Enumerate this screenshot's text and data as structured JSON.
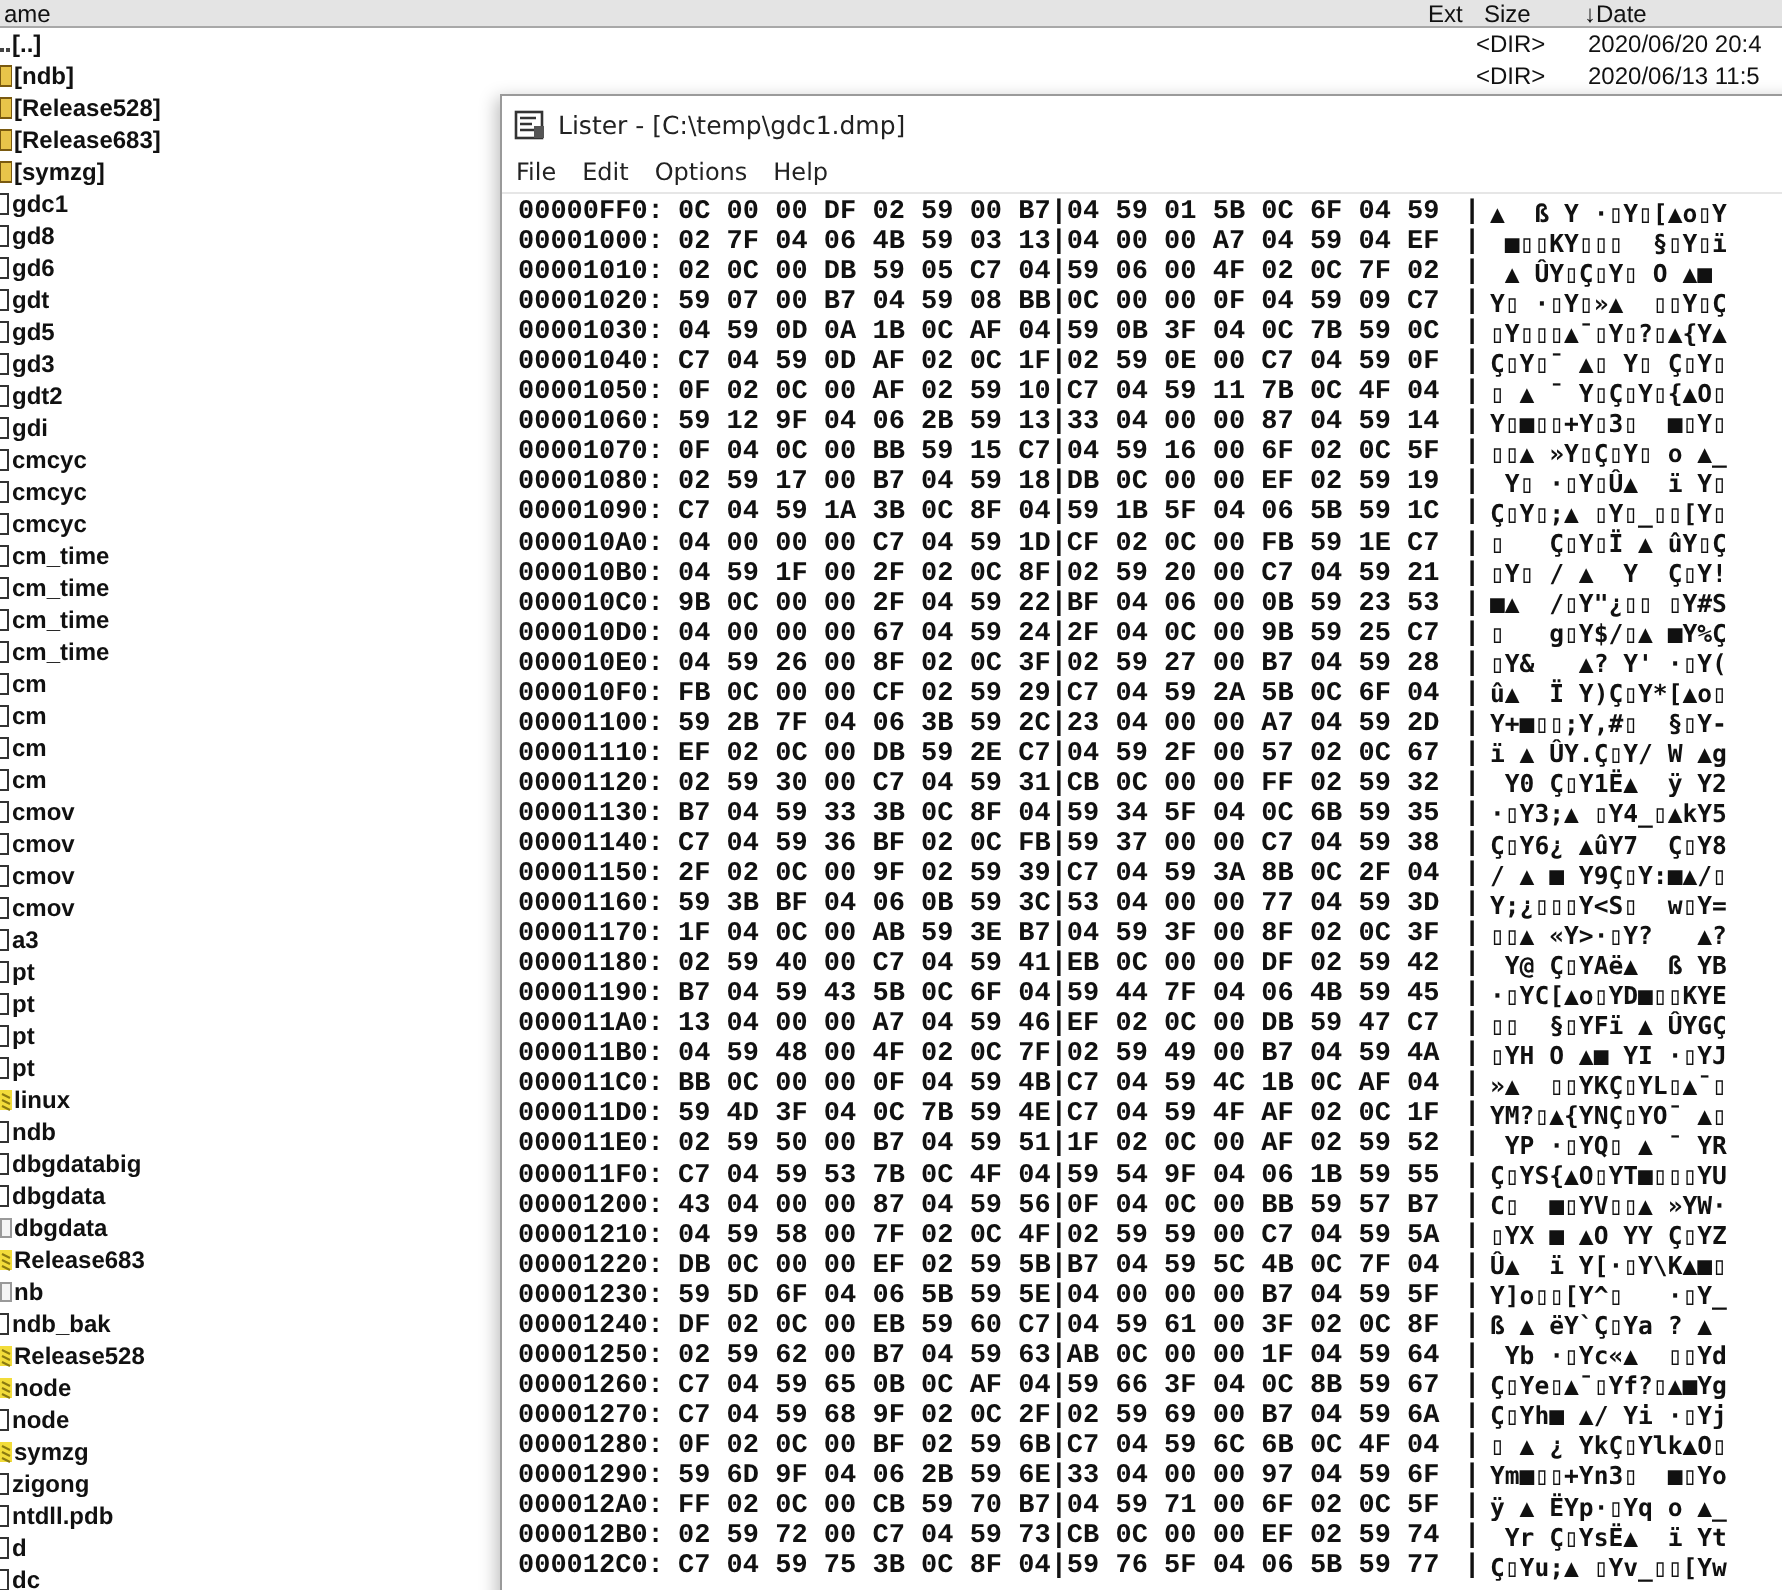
{
  "file_panel": {
    "columns": [
      "ame",
      "Ext",
      "Size",
      "↓Date"
    ],
    "items": [
      {
        "name": "[..]",
        "kind": "up",
        "size": "<DIR>",
        "date": "2020/06/20 20:4"
      },
      {
        "name": "[ndb]",
        "kind": "folder",
        "size": "<DIR>",
        "date": "2020/06/13 11:5"
      },
      {
        "name": "[Release528]",
        "kind": "folder"
      },
      {
        "name": "[Release683]",
        "kind": "folder"
      },
      {
        "name": "[symzg]",
        "kind": "folder"
      },
      {
        "name": "gdc1",
        "kind": "file"
      },
      {
        "name": "gd8",
        "kind": "file"
      },
      {
        "name": "gd6",
        "kind": "file"
      },
      {
        "name": "gdt",
        "kind": "file"
      },
      {
        "name": "gd5",
        "kind": "file"
      },
      {
        "name": "gd3",
        "kind": "file"
      },
      {
        "name": "gdt2",
        "kind": "file"
      },
      {
        "name": "gdi",
        "kind": "file"
      },
      {
        "name": "cmcyc",
        "kind": "file"
      },
      {
        "name": "cmcyc",
        "kind": "file"
      },
      {
        "name": "cmcyc",
        "kind": "file"
      },
      {
        "name": "cm_time",
        "kind": "file"
      },
      {
        "name": "cm_time",
        "kind": "file"
      },
      {
        "name": "cm_time",
        "kind": "file"
      },
      {
        "name": "cm_time",
        "kind": "file"
      },
      {
        "name": "cm",
        "kind": "file"
      },
      {
        "name": "cm",
        "kind": "file"
      },
      {
        "name": "cm",
        "kind": "file"
      },
      {
        "name": "cm",
        "kind": "file"
      },
      {
        "name": "cmov",
        "kind": "file"
      },
      {
        "name": "cmov",
        "kind": "file"
      },
      {
        "name": "cmov",
        "kind": "file"
      },
      {
        "name": "cmov",
        "kind": "file"
      },
      {
        "name": "a3",
        "kind": "file"
      },
      {
        "name": "pt",
        "kind": "file"
      },
      {
        "name": "pt",
        "kind": "file"
      },
      {
        "name": "pt",
        "kind": "file"
      },
      {
        "name": "pt",
        "kind": "file"
      },
      {
        "name": "linux",
        "kind": "archive"
      },
      {
        "name": "ndb",
        "kind": "file"
      },
      {
        "name": "dbgdatabig",
        "kind": "file"
      },
      {
        "name": "dbgdata",
        "kind": "file"
      },
      {
        "name": "dbgdata",
        "kind": "document"
      },
      {
        "name": "Release683",
        "kind": "archive"
      },
      {
        "name": "nb",
        "kind": "document"
      },
      {
        "name": "ndb_bak",
        "kind": "file"
      },
      {
        "name": "Release528",
        "kind": "archive"
      },
      {
        "name": "node",
        "kind": "archive"
      },
      {
        "name": "node",
        "kind": "file"
      },
      {
        "name": "symzg",
        "kind": "archive"
      },
      {
        "name": "zigong",
        "kind": "file"
      },
      {
        "name": "ntdll.pdb",
        "kind": "file"
      },
      {
        "name": "d",
        "kind": "file"
      },
      {
        "name": "dc",
        "kind": "file"
      }
    ]
  },
  "lister": {
    "title": "Lister - [C:\\temp\\gdc1.dmp]",
    "menu": [
      "File",
      "Edit",
      "Options",
      "Help"
    ],
    "separator": "|",
    "rows": [
      {
        "offset": "00000FF0:",
        "hex": "0C 00 00 DF 02 59 00 B7|04 59 01 5B 0C 6F 04 59",
        "ascii": "▲  ß Y ·▯Y▯[▲o▯Y"
      },
      {
        "offset": "00001000:",
        "hex": "02 7F 04 06 4B 59 03 13|04 00 00 A7 04 59 04 EF",
        "ascii": " ■▯▯KY▯▯▯  §▯Y▯ï"
      },
      {
        "offset": "00001010:",
        "hex": "02 0C 00 DB 59 05 C7 04|59 06 00 4F 02 0C 7F 02",
        "ascii": " ▲ ÛY▯Ç▯Y▯ O ▲■ "
      },
      {
        "offset": "00001020:",
        "hex": "59 07 00 B7 04 59 08 BB|0C 00 00 0F 04 59 09 C7",
        "ascii": "Y▯ ·▯Y▯»▲  ▯▯Y▯Ç"
      },
      {
        "offset": "00001030:",
        "hex": "04 59 0D 0A 1B 0C AF 04|59 0B 3F 04 0C 7B 59 0C",
        "ascii": "▯Y▯▯▯▲¯▯Y▯?▯▲{Y▲"
      },
      {
        "offset": "00001040:",
        "hex": "C7 04 59 0D AF 02 0C 1F|02 59 0E 00 C7 04 59 0F",
        "ascii": "Ç▯Y▯¯ ▲▯ Y▯ Ç▯Y▯"
      },
      {
        "offset": "00001050:",
        "hex": "0F 02 0C 00 AF 02 59 10|C7 04 59 11 7B 0C 4F 04",
        "ascii": "▯ ▲ ¯ Y▯Ç▯Y▯{▲O▯"
      },
      {
        "offset": "00001060:",
        "hex": "59 12 9F 04 06 2B 59 13|33 04 00 00 87 04 59 14",
        "ascii": "Y▯■▯▯+Y▯3▯  ■▯Y▯"
      },
      {
        "offset": "00001070:",
        "hex": "0F 04 0C 00 BB 59 15 C7|04 59 16 00 6F 02 0C 5F",
        "ascii": "▯▯▲ »Y▯Ç▯Y▯ o ▲_"
      },
      {
        "offset": "00001080:",
        "hex": "02 59 17 00 B7 04 59 18|DB 0C 00 00 EF 02 59 19",
        "ascii": " Y▯ ·▯Y▯Û▲  ï Y▯"
      },
      {
        "offset": "00001090:",
        "hex": "C7 04 59 1A 3B 0C 8F 04|59 1B 5F 04 06 5B 59 1C",
        "ascii": "Ç▯Y▯;▲ ▯Y▯_▯▯[Y▯"
      },
      {
        "offset": "000010A0:",
        "hex": "04 00 00 00 C7 04 59 1D|CF 02 0C 00 FB 59 1E C7",
        "ascii": "▯   Ç▯Y▯Ï ▲ ûY▯Ç"
      },
      {
        "offset": "000010B0:",
        "hex": "04 59 1F 00 2F 02 0C 8F|02 59 20 00 C7 04 59 21",
        "ascii": "▯Y▯ / ▲  Y  Ç▯Y!"
      },
      {
        "offset": "000010C0:",
        "hex": "9B 0C 00 00 2F 04 59 22|BF 04 06 00 0B 59 23 53",
        "ascii": "■▲  /▯Y\"¿▯▯ ▯Y#S"
      },
      {
        "offset": "000010D0:",
        "hex": "04 00 00 00 67 04 59 24|2F 04 0C 00 9B 59 25 C7",
        "ascii": "▯   g▯Y$/▯▲ ■Y%Ç"
      },
      {
        "offset": "000010E0:",
        "hex": "04 59 26 00 8F 02 0C 3F|02 59 27 00 B7 04 59 28",
        "ascii": "▯Y&   ▲? Y' ·▯Y("
      },
      {
        "offset": "000010F0:",
        "hex": "FB 0C 00 00 CF 02 59 29|C7 04 59 2A 5B 0C 6F 04",
        "ascii": "û▲  Ï Y)Ç▯Y*[▲o▯"
      },
      {
        "offset": "00001100:",
        "hex": "59 2B 7F 04 06 3B 59 2C|23 04 00 00 A7 04 59 2D",
        "ascii": "Y+■▯▯;Y,#▯  §▯Y-"
      },
      {
        "offset": "00001110:",
        "hex": "EF 02 0C 00 DB 59 2E C7|04 59 2F 00 57 02 0C 67",
        "ascii": "ï ▲ ÛY.Ç▯Y/ W ▲g"
      },
      {
        "offset": "00001120:",
        "hex": "02 59 30 00 C7 04 59 31|CB 0C 00 00 FF 02 59 32",
        "ascii": " Y0 Ç▯Y1Ë▲  ÿ Y2"
      },
      {
        "offset": "00001130:",
        "hex": "B7 04 59 33 3B 0C 8F 04|59 34 5F 04 0C 6B 59 35",
        "ascii": "·▯Y3;▲ ▯Y4_▯▲kY5"
      },
      {
        "offset": "00001140:",
        "hex": "C7 04 59 36 BF 02 0C FB|59 37 00 00 C7 04 59 38",
        "ascii": "Ç▯Y6¿ ▲ûY7  Ç▯Y8"
      },
      {
        "offset": "00001150:",
        "hex": "2F 02 0C 00 9F 02 59 39|C7 04 59 3A 8B 0C 2F 04",
        "ascii": "/ ▲ ■ Y9Ç▯Y:■▲/▯"
      },
      {
        "offset": "00001160:",
        "hex": "59 3B BF 04 06 0B 59 3C|53 04 00 00 77 04 59 3D",
        "ascii": "Y;¿▯▯▯Y<S▯  w▯Y="
      },
      {
        "offset": "00001170:",
        "hex": "1F 04 0C 00 AB 59 3E B7|04 59 3F 00 8F 02 0C 3F",
        "ascii": "▯▯▲ «Y>·▯Y?   ▲?"
      },
      {
        "offset": "00001180:",
        "hex": "02 59 40 00 C7 04 59 41|EB 0C 00 00 DF 02 59 42",
        "ascii": " Y@ Ç▯YAë▲  ß YB"
      },
      {
        "offset": "00001190:",
        "hex": "B7 04 59 43 5B 0C 6F 04|59 44 7F 04 06 4B 59 45",
        "ascii": "·▯YC[▲o▯YD■▯▯KYE"
      },
      {
        "offset": "000011A0:",
        "hex": "13 04 00 00 A7 04 59 46|EF 02 0C 00 DB 59 47 C7",
        "ascii": "▯▯  §▯YFï ▲ ÛYGÇ"
      },
      {
        "offset": "000011B0:",
        "hex": "04 59 48 00 4F 02 0C 7F|02 59 49 00 B7 04 59 4A",
        "ascii": "▯YH O ▲■ YI ·▯YJ"
      },
      {
        "offset": "000011C0:",
        "hex": "BB 0C 00 00 0F 04 59 4B|C7 04 59 4C 1B 0C AF 04",
        "ascii": "»▲  ▯▯YKÇ▯YL▯▲¯▯"
      },
      {
        "offset": "000011D0:",
        "hex": "59 4D 3F 04 0C 7B 59 4E|C7 04 59 4F AF 02 0C 1F",
        "ascii": "YM?▯▲{YNÇ▯YO¯ ▲▯"
      },
      {
        "offset": "000011E0:",
        "hex": "02 59 50 00 B7 04 59 51|1F 02 0C 00 AF 02 59 52",
        "ascii": " YP ·▯YQ▯ ▲ ¯ YR"
      },
      {
        "offset": "000011F0:",
        "hex": "C7 04 59 53 7B 0C 4F 04|59 54 9F 04 06 1B 59 55",
        "ascii": "Ç▯YS{▲O▯YT■▯▯▯YU"
      },
      {
        "offset": "00001200:",
        "hex": "43 04 00 00 87 04 59 56|0F 04 0C 00 BB 59 57 B7",
        "ascii": "C▯  ■▯YV▯▯▲ »YW·"
      },
      {
        "offset": "00001210:",
        "hex": "04 59 58 00 7F 02 0C 4F|02 59 59 00 C7 04 59 5A",
        "ascii": "▯YX ■ ▲O YY Ç▯YZ"
      },
      {
        "offset": "00001220:",
        "hex": "DB 0C 00 00 EF 02 59 5B|B7 04 59 5C 4B 0C 7F 04",
        "ascii": "Û▲  ï Y[·▯Y\\K▲■▯"
      },
      {
        "offset": "00001230:",
        "hex": "59 5D 6F 04 06 5B 59 5E|04 00 00 00 B7 04 59 5F",
        "ascii": "Y]o▯▯[Y^▯   ·▯Y_"
      },
      {
        "offset": "00001240:",
        "hex": "DF 02 0C 00 EB 59 60 C7|04 59 61 00 3F 02 0C 8F",
        "ascii": "ß ▲ ëY`Ç▯Ya ? ▲ "
      },
      {
        "offset": "00001250:",
        "hex": "02 59 62 00 B7 04 59 63|AB 0C 00 00 1F 04 59 64",
        "ascii": " Yb ·▯Yc«▲  ▯▯Yd"
      },
      {
        "offset": "00001260:",
        "hex": "C7 04 59 65 0B 0C AF 04|59 66 3F 04 0C 8B 59 67",
        "ascii": "Ç▯Ye▯▲¯▯Yf?▯▲■Yg"
      },
      {
        "offset": "00001270:",
        "hex": "C7 04 59 68 9F 02 0C 2F|02 59 69 00 B7 04 59 6A",
        "ascii": "Ç▯Yh■ ▲/ Yi ·▯Yj"
      },
      {
        "offset": "00001280:",
        "hex": "0F 02 0C 00 BF 02 59 6B|C7 04 59 6C 6B 0C 4F 04",
        "ascii": "▯ ▲ ¿ YkÇ▯Ylk▲O▯"
      },
      {
        "offset": "00001290:",
        "hex": "59 6D 9F 04 06 2B 59 6E|33 04 00 00 97 04 59 6F",
        "ascii": "Ym■▯▯+Yn3▯  ■▯Yo"
      },
      {
        "offset": "000012A0:",
        "hex": "FF 02 0C 00 CB 59 70 B7|04 59 71 00 6F 02 0C 5F",
        "ascii": "ÿ ▲ ËYp·▯Yq o ▲_"
      },
      {
        "offset": "000012B0:",
        "hex": "02 59 72 00 C7 04 59 73|CB 0C 00 00 EF 02 59 74",
        "ascii": " Yr Ç▯YsË▲  ï Yt"
      },
      {
        "offset": "000012C0:",
        "hex": "C7 04 59 75 3B 0C 8F 04|59 76 5F 04 06 5B 59 77",
        "ascii": "Ç▯Yu;▲ ▯Yv_▯▯[Yw"
      }
    ]
  }
}
